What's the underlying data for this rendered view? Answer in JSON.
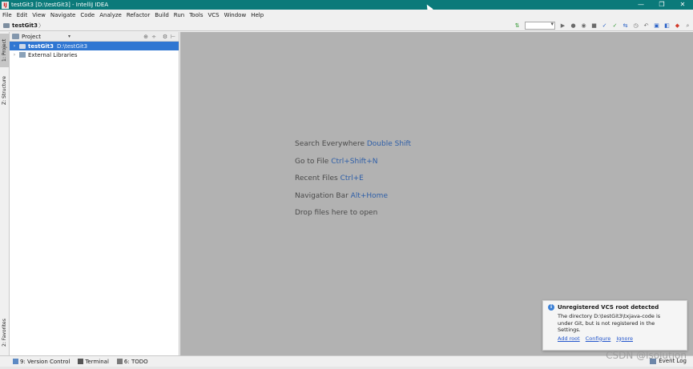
{
  "window": {
    "title": "testGit3 [D:\\testGit3] - IntelliJ IDEA",
    "app_icon": "IJ",
    "controls": [
      "—",
      "❐",
      "✕"
    ]
  },
  "menu": [
    "File",
    "Edit",
    "View",
    "Navigate",
    "Code",
    "Analyze",
    "Refactor",
    "Build",
    "Run",
    "Tools",
    "VCS",
    "Window",
    "Help"
  ],
  "navbar": {
    "crumb": "testGit3",
    "crumb_arrow": "〉",
    "tool_icons": [
      "build-icon",
      "run-combo",
      "run-icon",
      "debug-icon",
      "coverage-icon",
      "stop-icon",
      "vcs-update-icon",
      "vcs-commit-icon",
      "vcs-compare-icon",
      "vcs-history-icon",
      "revert-icon",
      "project-structure-icon",
      "sdk-icon",
      "search-icon"
    ]
  },
  "left_strip": {
    "project_tab": "1: Project",
    "structure_tab": "Z: Structure",
    "favorites_tab": "2: Favorites"
  },
  "project_panel": {
    "header_label": "Project",
    "dropdown": "▾",
    "header_buttons": [
      "⊕",
      "÷",
      "⚙",
      "⊢"
    ],
    "tree": [
      {
        "arrow": "›",
        "name": "testGit3",
        "path": "D:\\testGit3",
        "selected": true
      },
      {
        "arrow": "›",
        "name": "External Libraries",
        "path": "",
        "selected": false
      }
    ]
  },
  "editor_hints": [
    {
      "text": "Search Everywhere",
      "shortcut": "Double Shift"
    },
    {
      "text": "Go to File",
      "shortcut": "Ctrl+Shift+N"
    },
    {
      "text": "Recent Files",
      "shortcut": "Ctrl+E"
    },
    {
      "text": "Navigation Bar",
      "shortcut": "Alt+Home"
    },
    {
      "text": "Drop files here to open",
      "shortcut": ""
    }
  ],
  "notification": {
    "icon": "i",
    "title": "Unregistered VCS root detected",
    "body": "The directory D:\\testGit3\\txjava-code is under Git, but is not registered in the Settings.",
    "links": [
      "Add root",
      "Configure",
      "Ignore"
    ]
  },
  "statusbar": {
    "tabs": [
      "9: Version Control",
      "Terminal",
      "6: TODO"
    ],
    "event_log": "Event Log"
  },
  "watermark": "CSDN @lsolution"
}
